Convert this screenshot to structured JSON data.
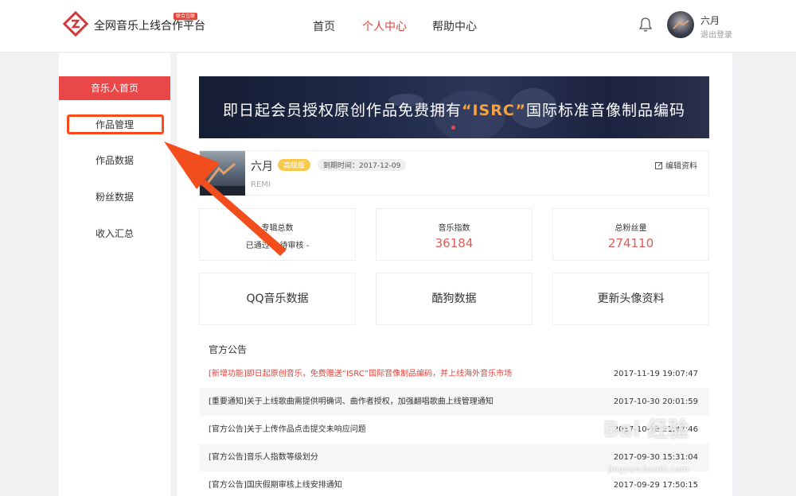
{
  "header": {
    "brand": "全网音乐上线合作平台",
    "brand_badge": "联合互联",
    "nav": [
      "首页",
      "个人中心",
      "帮助中心"
    ],
    "active_nav": "个人中心",
    "user_name": "六月",
    "logout": "退出登录"
  },
  "sidebar": {
    "items": [
      "音乐人首页",
      "作品管理",
      "作品数据",
      "粉丝数据",
      "收入汇总"
    ]
  },
  "banner": {
    "text_before": "即日起会员授权原创作品免费拥有",
    "text_isrc": "“ISRC”",
    "text_after": "国际标准音像制品编码"
  },
  "profile": {
    "name": "六月",
    "level": "高级版",
    "expire": "到期时间：2017-12-09",
    "sub": "REMI",
    "edit": "编辑资料"
  },
  "stats": [
    {
      "title": "专辑总数",
      "sub": "已通过 2     待审核 -"
    },
    {
      "title": "音乐指数",
      "value": "36184"
    },
    {
      "title": "总粉丝量",
      "value": "274110"
    }
  ],
  "actions": [
    "QQ音乐数据",
    "酷狗数据",
    "更新头像资料"
  ],
  "notices": {
    "title": "官方公告",
    "items": [
      {
        "text": "[新增功能]即日起原创音乐，免费赠送“ISRC”国际音像制品编码，并上线海外音乐市场",
        "date": "2017-11-19 19:07:47"
      },
      {
        "text": "[重要通知]关于上线歌曲需提供明确词、曲作者授权，加强翻唱歌曲上线管理通知",
        "date": "2017-10-30 20:01:59"
      },
      {
        "text": "[官方公告]关于上传作品点击提交未响应问题",
        "date": "2017-10-18 21:47:46"
      },
      {
        "text": "[官方公告]音乐人指数等级划分",
        "date": "2017-09-30 15:31:04"
      },
      {
        "text": "[官方公告]国庆假期审核上线安排通知",
        "date": "2017-09-29 17:50:15"
      }
    ]
  },
  "watermark": {
    "text": "Bai 经验",
    "url": "jingyan.baidu.com"
  },
  "colors": {
    "accent": "#e94748",
    "annotation": "#ff4a1c"
  }
}
